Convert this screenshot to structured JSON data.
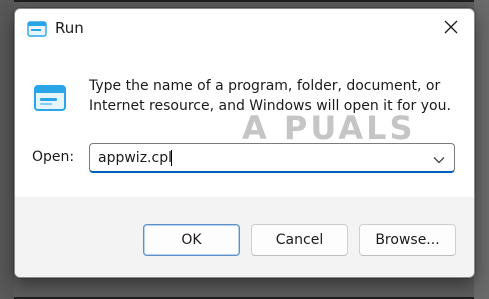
{
  "dialog": {
    "title": "Run",
    "description": "Type the name of a program, folder, document, or Internet resource, and Windows will open it for you.",
    "open_label": "Open:",
    "open_value": "appwiz.cpl"
  },
  "buttons": {
    "ok": "OK",
    "cancel": "Cancel",
    "browse": "Browse..."
  },
  "icons": {
    "title_icon": "run-app-icon",
    "big_icon": "run-app-icon",
    "close": "close-icon",
    "dropdown": "chevron-down-icon"
  },
  "watermark": {
    "text": "A  PUALS"
  },
  "colors": {
    "accent": "#005fb8",
    "icon_blue": "#2aa6e8"
  }
}
